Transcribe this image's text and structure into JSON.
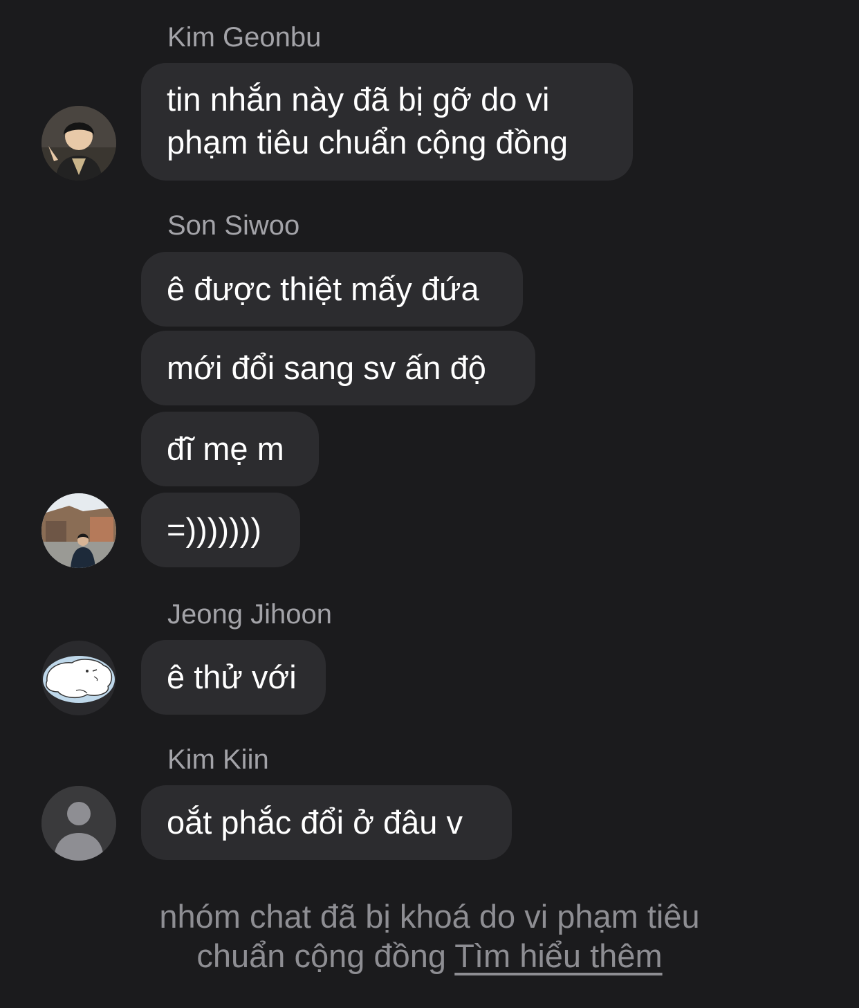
{
  "colors": {
    "background": "#1b1b1d",
    "bubble": "#2c2c2f",
    "message_text": "#ffffff",
    "sender_name": "#a3a3a8",
    "notice_text": "#8e8e93"
  },
  "groups": [
    {
      "sender": "Kim Geonbu",
      "avatar_icon": "profile-photo",
      "messages": [
        "tin nhắn này đã bị gỡ do vi",
        "phạm tiêu chuẩn cộng đồng"
      ]
    },
    {
      "sender": "Son Siwoo",
      "avatar_icon": "profile-photo",
      "messages": [
        "ê được thiệt mấy đứa",
        "mới đổi sang sv ấn độ",
        "đĩ mẹ m",
        "=)))))))"
      ]
    },
    {
      "sender": "Jeong Jihoon",
      "avatar_icon": "sticker-avatar",
      "messages": [
        "ê thử với"
      ]
    },
    {
      "sender": "Kim Kiin",
      "avatar_icon": "default-person-icon",
      "messages": [
        "oắt phắc đổi ở đâu v"
      ]
    }
  ],
  "footer": {
    "notice_line1": "nhóm chat đã bị khoá do vi phạm tiêu",
    "notice_line2": "chuẩn cộng đồng ",
    "learn_more": "Tìm hiểu thêm"
  }
}
